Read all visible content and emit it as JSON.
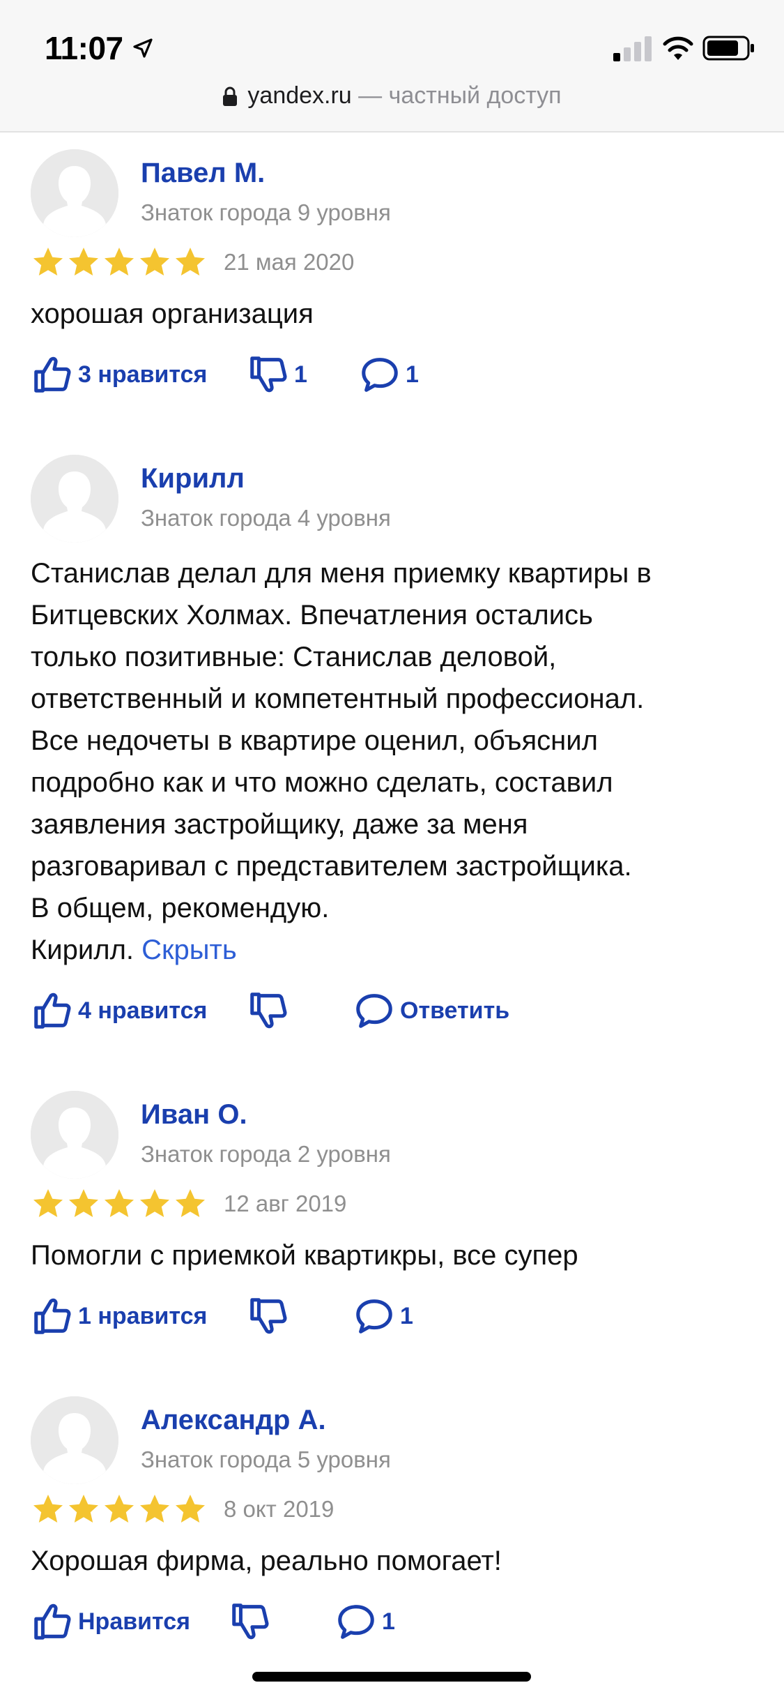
{
  "status_bar": {
    "time": "11:07",
    "url_domain": "yandex.ru",
    "url_suffix": " — частный доступ"
  },
  "colors": {
    "accent": "#1a3fae",
    "link": "#2d5ed6",
    "star": "#f4c430",
    "muted": "#8f8f8f"
  },
  "reviews": [
    {
      "author": "Павел М.",
      "level": "Знаток города 9 уровня",
      "rating": 5,
      "date": "21 мая 2020",
      "text": "хорошая организация",
      "likes": "3 нравится",
      "dislikes": "1",
      "comments": "1"
    },
    {
      "author": "Кирилл",
      "level": "Знаток города 4 уровня",
      "text_lines": [
        "Станислав делал для меня приемку квартиры в",
        "Битцевских Холмах. Впечатления остались",
        "только позитивные: Станислав деловой,",
        "ответственный и компетентный профессионал.",
        "Все недочеты в квартире оценил, объяснил",
        "подробно как и что можно сделать, составил",
        "заявления застройщику, даже за меня",
        "разговаривал с представителем застройщика.",
        "В общем, рекомендую.",
        "Кирилл. "
      ],
      "hide_label": "Скрыть",
      "likes": "4 нравится",
      "reply_label": "Ответить"
    },
    {
      "author": "Иван О.",
      "level": "Знаток города 2 уровня",
      "rating": 5,
      "date": "12 авг 2019",
      "text": "Помогли с приемкой квартикры, все супер",
      "likes": "1 нравится",
      "comments": "1"
    },
    {
      "author": "Александр А.",
      "level": "Знаток города 5 уровня",
      "rating": 5,
      "date": "8 окт 2019",
      "text": "Хорошая фирма, реально помогает!",
      "likes": "Нравится",
      "comments": "1"
    }
  ]
}
